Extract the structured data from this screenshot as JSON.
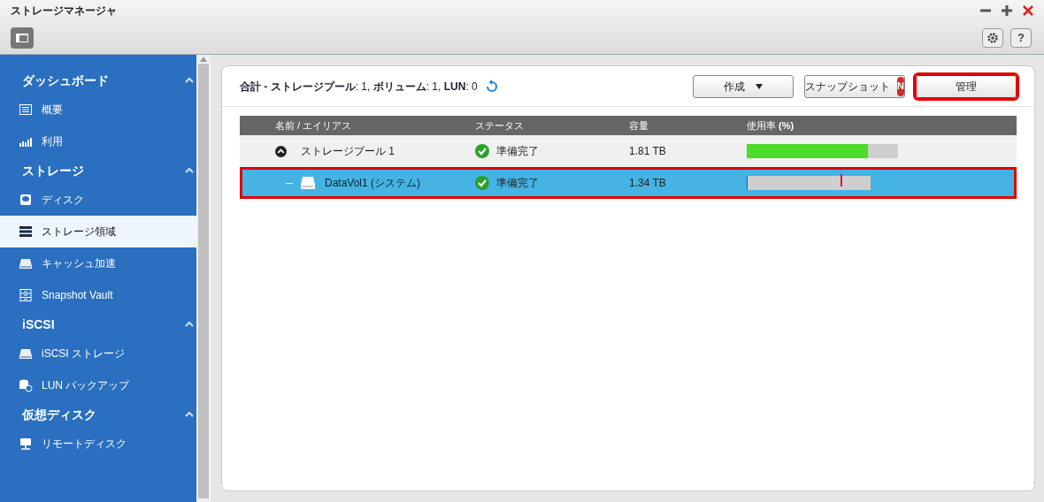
{
  "window": {
    "title": "ストレージマネージャ"
  },
  "toolbar": {
    "help_label": "?"
  },
  "sidebar": {
    "sections": [
      {
        "title": "ダッシュボード",
        "expanded": true,
        "items": [
          {
            "label": "概要",
            "selected": false
          },
          {
            "label": "利用",
            "selected": false
          }
        ]
      },
      {
        "title": "ストレージ",
        "expanded": true,
        "items": [
          {
            "label": "ディスク",
            "selected": false
          },
          {
            "label": "ストレージ領域",
            "selected": true
          },
          {
            "label": "キャッシュ加速",
            "selected": false
          },
          {
            "label": "Snapshot Vault",
            "selected": false
          }
        ]
      },
      {
        "title": "iSCSI",
        "expanded": true,
        "items": [
          {
            "label": "iSCSI ストレージ",
            "selected": false
          },
          {
            "label": "LUN バックアップ",
            "selected": false
          }
        ]
      },
      {
        "title": "仮想ディスク",
        "expanded": true,
        "items": [
          {
            "label": "リモートディスク",
            "selected": false
          }
        ]
      }
    ]
  },
  "summary": "**合計 - ストレージプール**: 1, **ボリューム**: 1, **LUN**: 0",
  "buttons": [
    {
      "label": "作成",
      "kind": "dropdown",
      "highlighted": false
    },
    {
      "label": "スナップショット",
      "kind": "badge",
      "badge": "N",
      "highlighted": false
    },
    {
      "label": "管理",
      "kind": "plain",
      "highlighted": true
    }
  ],
  "table": {
    "column_labels": [
      "名前 / エイリアス",
      "ステータス",
      "容量",
      "使用率 **(%)**"
    ],
    "rows": [
      {
        "kind": "pool",
        "name": "ストレージプール 1",
        "status": "準備完了",
        "capacity": "1.81 TB",
        "level": 0.8,
        "expanded": true,
        "selected": false,
        "highlighted": false
      },
      {
        "kind": "volume",
        "name": "DataVol1 (システム)",
        "status": "準備完了",
        "capacity": "1.34 TB",
        "level": 0.01,
        "selected": true,
        "highlighted": true
      }
    ]
  }
}
